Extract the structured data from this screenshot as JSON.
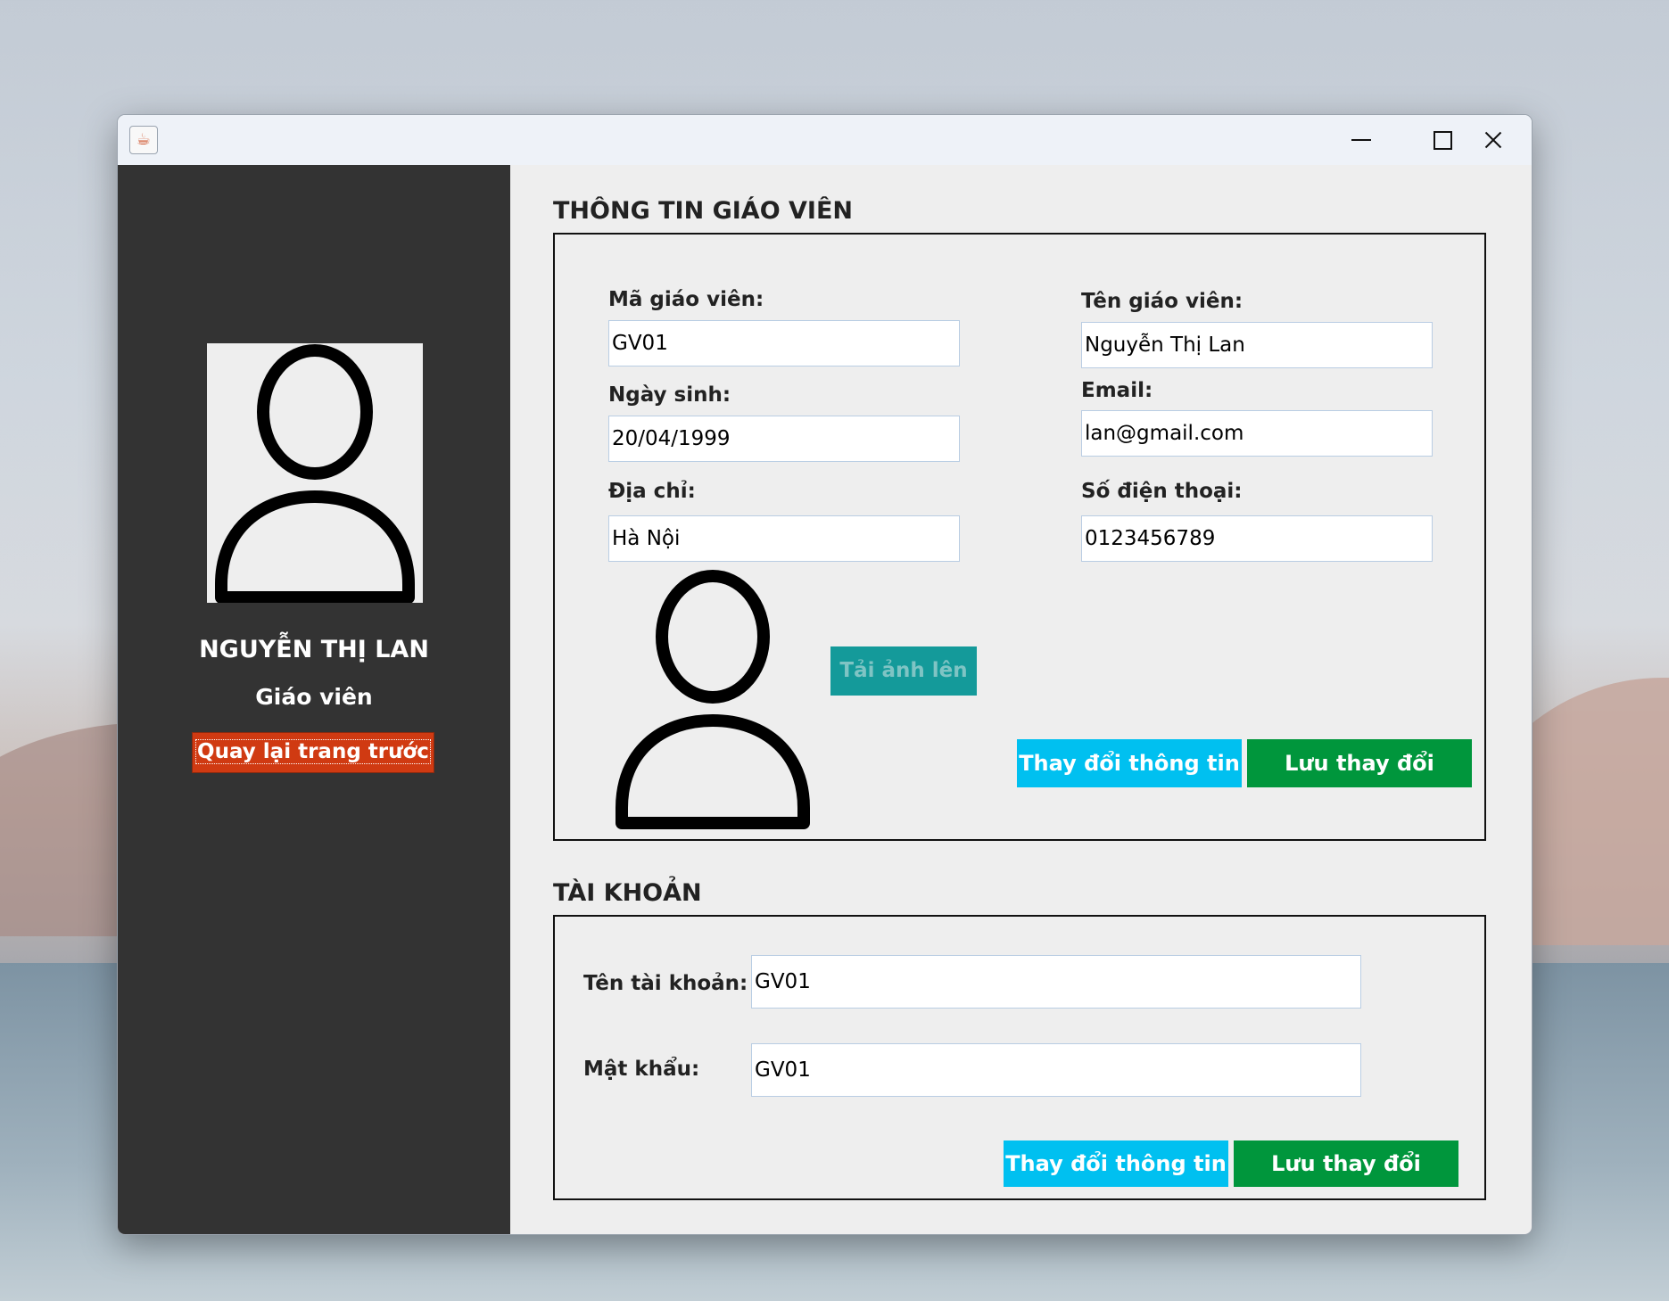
{
  "window": {
    "minimize_label": "",
    "maximize_label": "",
    "close_label": ""
  },
  "sidebar": {
    "name": "NGUYỄN THỊ LAN",
    "role": "Giáo viên",
    "back_button": "Quay lại trang trước"
  },
  "teacher_info": {
    "title": "THÔNG TIN GIÁO VIÊN",
    "fields": {
      "code": {
        "label": "Mã giáo viên:",
        "value": "GV01"
      },
      "name": {
        "label": "Tên giáo viên:",
        "value": "Nguyễn Thị Lan"
      },
      "dob": {
        "label": "Ngày sinh:",
        "value": "20/04/1999"
      },
      "email": {
        "label": "Email:",
        "value": "lan@gmail.com"
      },
      "address": {
        "label": "Địa chỉ:",
        "value": "Hà Nội"
      },
      "phone": {
        "label": "Số điện thoại:",
        "value": "0123456789"
      }
    },
    "upload_button": "Tải ảnh lên",
    "edit_button": "Thay đổi thông tin",
    "save_button": "Lưu thay đổi"
  },
  "account": {
    "title": "TÀI KHOẢN",
    "username": {
      "label": "Tên tài khoản:",
      "value": "GV01"
    },
    "password": {
      "label": "Mật khẩu:",
      "value": "GV01"
    },
    "edit_button": "Thay đổi thông tin",
    "save_button": "Lưu thay đổi"
  }
}
